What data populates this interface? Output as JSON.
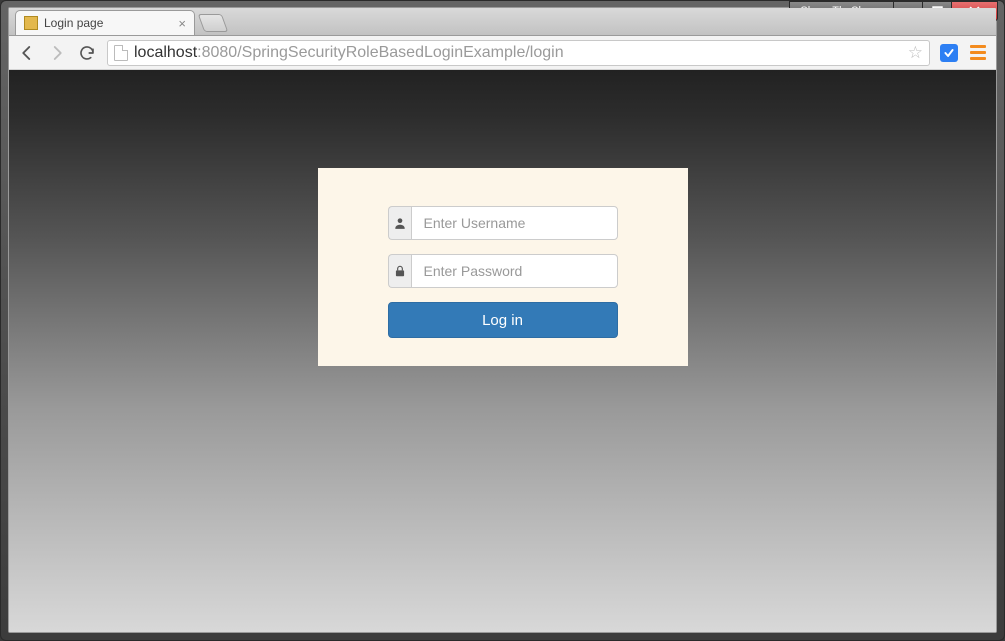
{
  "window": {
    "user_label": "ShaunTheSheep"
  },
  "browser": {
    "tab_title": "Login page",
    "url_host": "localhost",
    "url_rest": ":8080/SpringSecurityRoleBasedLoginExample/login"
  },
  "login": {
    "username_placeholder": "Enter Username",
    "password_placeholder": "Enter Password",
    "submit_label": "Log in"
  }
}
